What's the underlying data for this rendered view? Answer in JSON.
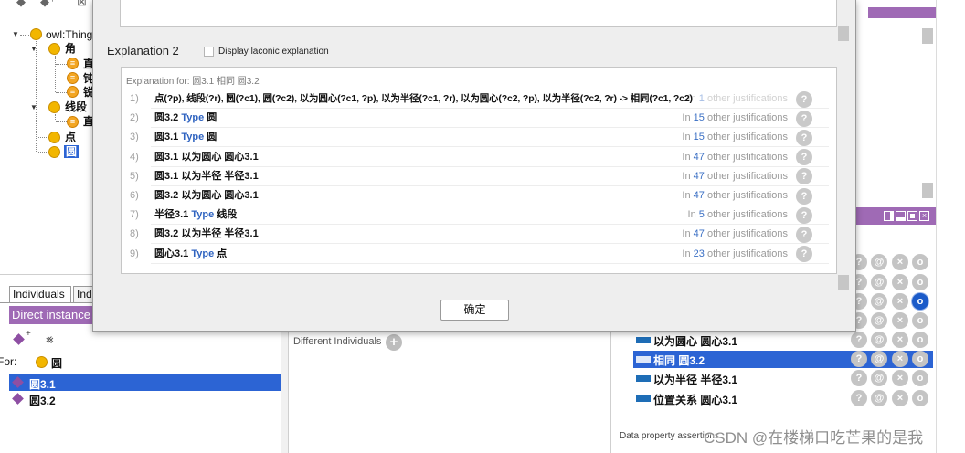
{
  "toolbar_icons": [
    "class-icon",
    "add-subclass-icon",
    "delete-class-icon"
  ],
  "class_tree": {
    "root": "owl:Thing",
    "angle": {
      "label": "角",
      "children": [
        "直",
        "钝",
        "锐"
      ]
    },
    "segment": {
      "label": "线段",
      "children": [
        "直"
      ]
    },
    "point": "点",
    "circle": {
      "label": "圆",
      "selected": true
    },
    "defined_glyph": "≡",
    "toggle_glyph": "▼"
  },
  "individuals_panel": {
    "tabs": [
      "Individuals",
      "Ind"
    ],
    "header": "Direct instance",
    "for_label": "For:",
    "for_class": "圆",
    "items": [
      {
        "label": "圆3.1",
        "selected": true
      },
      {
        "label": "圆3.2",
        "selected": false
      }
    ]
  },
  "middle_panel": {
    "different_individuals": "Different Individuals",
    "add_glyph": "+"
  },
  "property_assertions": {
    "rows": [
      {
        "property": "以为圆心",
        "value": "圆心3.1",
        "selected": false
      },
      {
        "property": "相同",
        "value": "圆3.2",
        "selected": true
      },
      {
        "property": "以为半径",
        "value": "半径3.1",
        "selected": false
      },
      {
        "property": "位置关系",
        "value": "圆心3.1",
        "selected": false
      }
    ],
    "data_property_label": "Data property assertions"
  },
  "row_buttons": [
    {
      "icon": "help-icon",
      "glyph": "?"
    },
    {
      "icon": "annotation-icon",
      "glyph": "@"
    },
    {
      "icon": "delete-icon",
      "glyph": "×"
    },
    {
      "icon": "edit-icon",
      "glyph": "o"
    }
  ],
  "dialog": {
    "title": "Explanation 2",
    "laconic_checkbox": {
      "label": "Display laconic explanation",
      "checked": false
    },
    "explanation_for": "Explanation for: 圆3.1 相同 圆3.2",
    "justification_prefix": "In",
    "justification_suffix": "other justifications",
    "help_glyph": "?",
    "rows": [
      {
        "number": "1)",
        "rule": "点(?p), 线段(?r), 圆(?c1), 圆(?c2), 以为圆心(?c1, ?p), 以为半径(?c1, ?r), 以为圆心(?c2, ?p), 以为半径(?c2, ?r) -> 相同(?c1, ?c2)",
        "count": "1"
      },
      {
        "number": "2)",
        "subject": "圆3.2",
        "predicate": "Type",
        "keyword": true,
        "object": "圆",
        "count": "15"
      },
      {
        "number": "3)",
        "subject": "圆3.1",
        "predicate": "Type",
        "keyword": true,
        "object": "圆",
        "count": "15"
      },
      {
        "number": "4)",
        "subject": "圆3.1",
        "predicate": "以为圆心",
        "keyword": false,
        "object": "圆心3.1",
        "count": "47"
      },
      {
        "number": "5)",
        "subject": "圆3.1",
        "predicate": "以为半径",
        "keyword": false,
        "object": "半径3.1",
        "count": "47"
      },
      {
        "number": "6)",
        "subject": "圆3.2",
        "predicate": "以为圆心",
        "keyword": false,
        "object": "圆心3.1",
        "count": "47"
      },
      {
        "number": "7)",
        "subject": "半径3.1",
        "predicate": "Type",
        "keyword": true,
        "object": "线段",
        "count": "5"
      },
      {
        "number": "8)",
        "subject": "圆3.2",
        "predicate": "以为半径",
        "keyword": false,
        "object": "半径3.1",
        "count": "47"
      },
      {
        "number": "9)",
        "subject": "圆心3.1",
        "predicate": "Type",
        "keyword": true,
        "object": "点",
        "count": "23"
      }
    ],
    "ok_button": "确定"
  },
  "watermark": "CSDN @在楼梯口吃芒果的是我",
  "colors": {
    "selection_blue": "#2c64d4",
    "header_purple": "#9f6ab5",
    "keyword_blue": "#2f63c0",
    "class_yellow": "#f2b600",
    "individual_purple": "#8e4fa3",
    "property_blue": "#1e6db6"
  }
}
